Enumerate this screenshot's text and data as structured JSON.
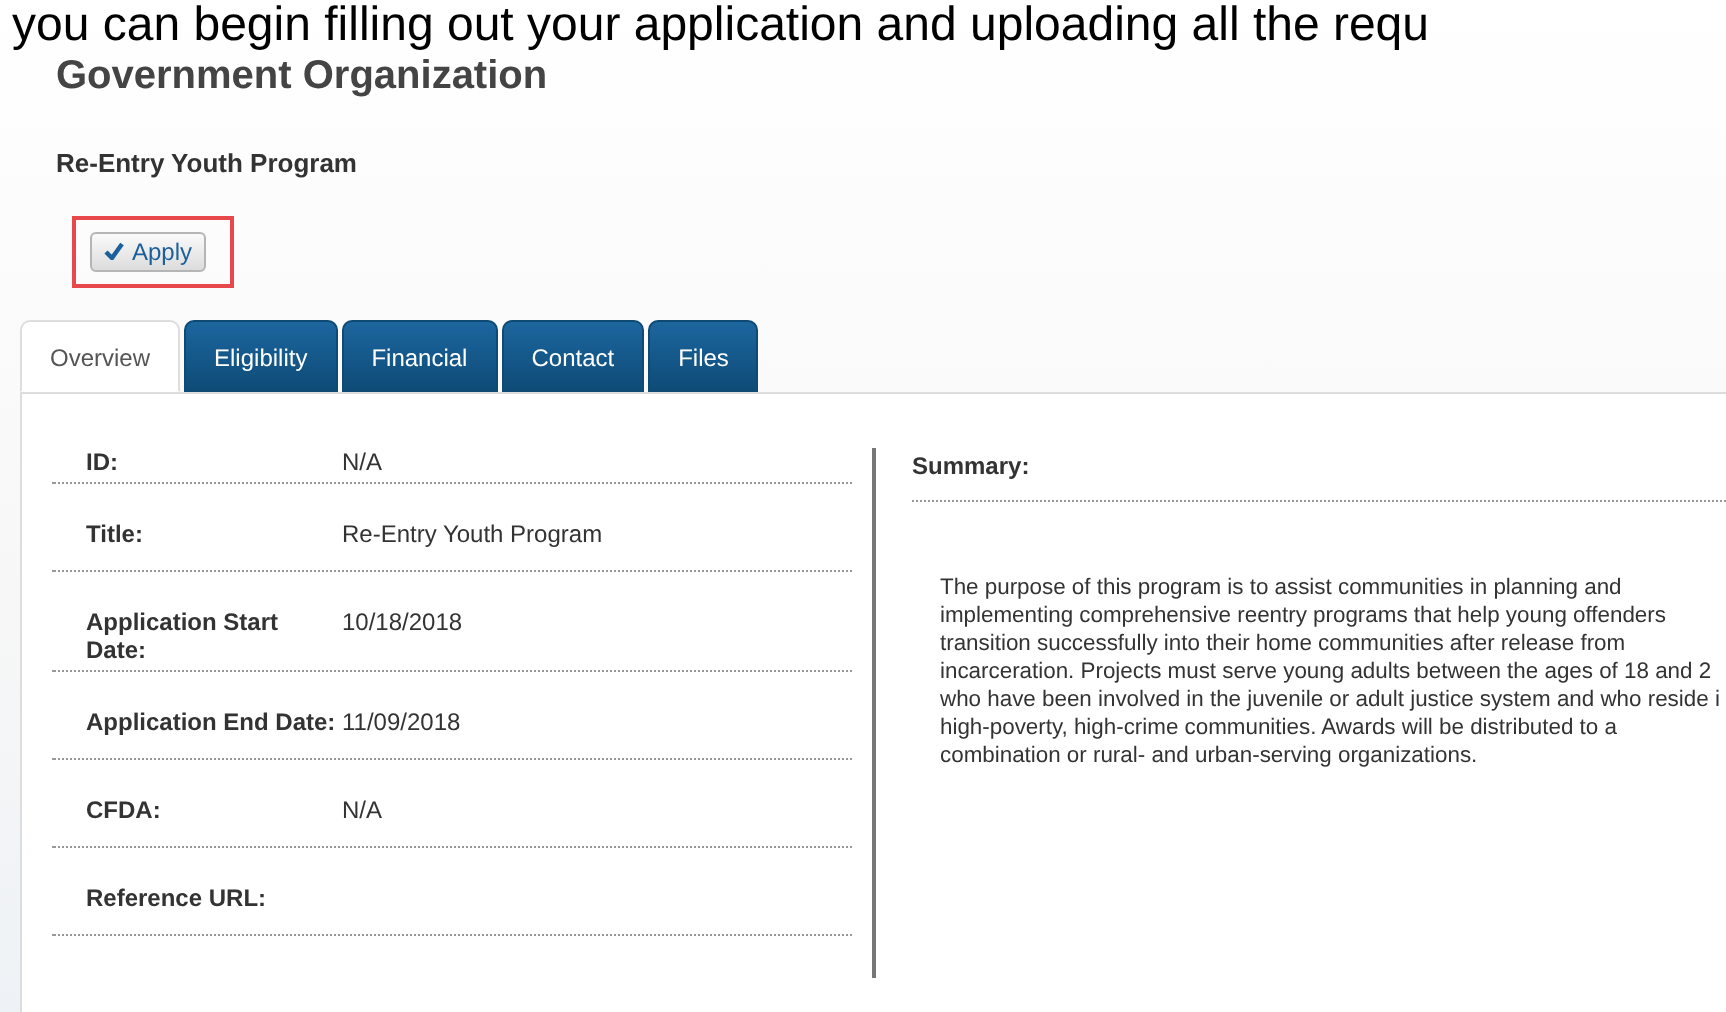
{
  "banner_text": "you can begin filling out your application and uploading all the requ",
  "organization": "Government Organization",
  "program_title": "Re-Entry Youth Program",
  "apply_button": {
    "label": "Apply"
  },
  "tabs": [
    {
      "label": "Overview",
      "selected": true
    },
    {
      "label": "Eligibility",
      "selected": false
    },
    {
      "label": "Financial",
      "selected": false
    },
    {
      "label": "Contact",
      "selected": false
    },
    {
      "label": "Files",
      "selected": false
    }
  ],
  "details": [
    {
      "label": "ID:",
      "value": "N/A"
    },
    {
      "label": "Title:",
      "value": "Re-Entry Youth Program"
    },
    {
      "label": "Application Start Date:",
      "value": "10/18/2018"
    },
    {
      "label": "Application End Date:",
      "value": "11/09/2018"
    },
    {
      "label": "CFDA:",
      "value": "N/A"
    },
    {
      "label": "Reference URL:"
    }
  ],
  "summary": {
    "label": "Summary:",
    "text": "The purpose of this program is to assist communities in planning and\nimplementing comprehensive reentry programs that help young offenders\ntransition successfully into their home communities after release from\nincarceration. Projects must serve young adults between the ages of 18 and 2\nwho have been involved in the juvenile or adult justice system and who reside i\nhigh-poverty, high-crime communities. Awards will be distributed to a\ncombination or rural- and urban-serving organizations."
  }
}
